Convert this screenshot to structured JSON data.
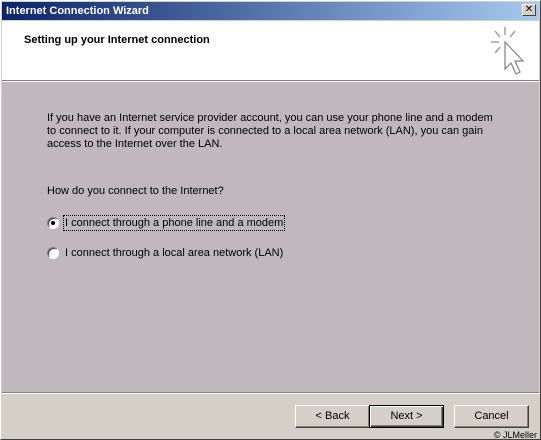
{
  "window": {
    "title": "Internet Connection Wizard",
    "close_label": "✕"
  },
  "header": {
    "title": "Setting up your Internet connection"
  },
  "content": {
    "description": "If you have an Internet service provider account, you can use your phone line and a modem to connect to it. If your computer is connected to a local area network (LAN), you can gain access to the Internet over the LAN.",
    "question": "How do you connect to the Internet?",
    "options": [
      {
        "label": "I connect through a phone line and a modem",
        "checked": true
      },
      {
        "label": "I connect through a local area network (LAN)",
        "checked": false
      }
    ]
  },
  "buttons": {
    "back": "< Back",
    "next": "Next >",
    "cancel": "Cancel"
  },
  "copyright": "© JLMeller"
}
